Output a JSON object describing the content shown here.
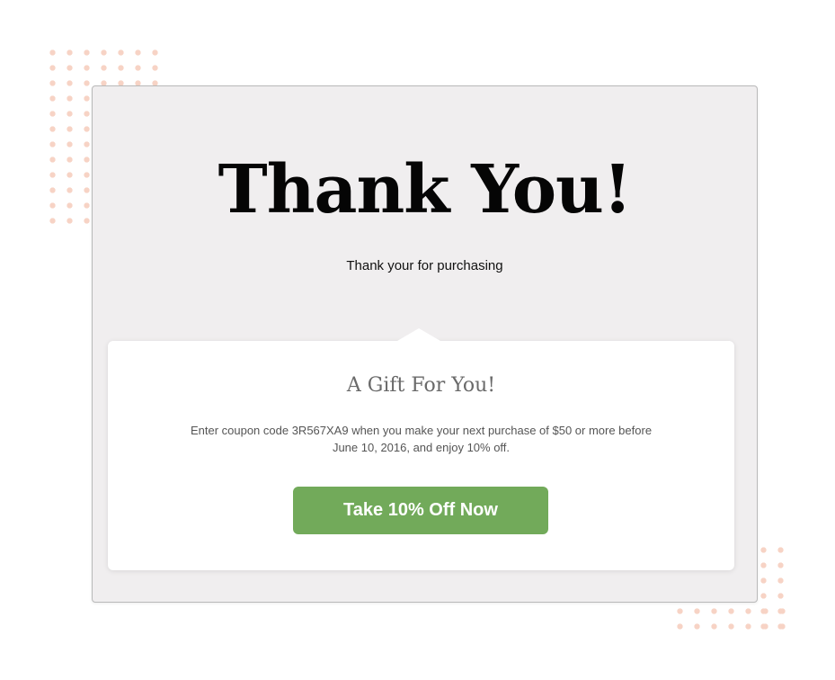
{
  "header": {
    "title": "Thank You!",
    "subtitle": "Thank your for purchasing"
  },
  "gift": {
    "title": "A Gift For You!",
    "message_line1": "Enter coupon code 3R567XA9 when you make your next purchase of $50 or more before",
    "message_line2": "June 10, 2016, and enjoy 10% off.",
    "button_label": "Take 10% Off Now"
  },
  "colors": {
    "card_background": "#f0eeef",
    "button": "#72aa5a",
    "dots": "#f7d3c5"
  }
}
